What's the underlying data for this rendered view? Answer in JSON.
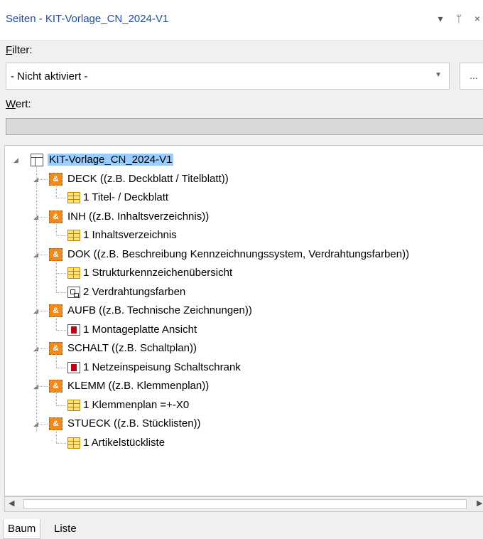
{
  "window": {
    "title": "Seiten - KIT-Vorlage_CN_2024-V1",
    "icons": [
      "dropdown-arrow-icon",
      "pin-icon",
      "close-icon"
    ]
  },
  "filter": {
    "label_accel": "F",
    "label_rest": "ilter:",
    "value": "- Nicht aktiviert -",
    "more_button": "..."
  },
  "wert": {
    "label_accel": "W",
    "label_rest": "ert:",
    "value": ""
  },
  "tree": {
    "root": "KIT-Vorlage_CN_2024-V1",
    "groups": [
      {
        "label": "DECK ((z.B. Deckblatt / Titelblatt))",
        "pages": [
          {
            "label": "1 Titel- / Deckblatt",
            "icon": "table-page-icon"
          }
        ]
      },
      {
        "label": "INH ((z.B. Inhaltsverzeichnis))",
        "pages": [
          {
            "label": "1 Inhaltsverzeichnis",
            "icon": "table-page-icon"
          }
        ]
      },
      {
        "label": "DOK ((z.B. Beschreibung Kennzeichnungssystem, Verdrahtungsfarben))",
        "pages": [
          {
            "label": "1 Strukturkennzeichenübersicht",
            "icon": "table-page-icon"
          },
          {
            "label": "2 Verdrahtungsfarben",
            "icon": "graphic-page-icon"
          }
        ]
      },
      {
        "label": "AUFB ((z.B. Technische Zeichnungen))",
        "pages": [
          {
            "label": "1 Montageplatte Ansicht",
            "icon": "schematic-page-icon"
          }
        ]
      },
      {
        "label": "SCHALT ((z.B. Schaltplan))",
        "pages": [
          {
            "label": "1 Netzeinspeisung Schaltschrank",
            "icon": "schematic-page-icon"
          }
        ]
      },
      {
        "label": "KLEMM ((z.B. Klemmenplan))",
        "pages": [
          {
            "label": "1 Klemmenplan =+-X0",
            "icon": "table-page-icon"
          }
        ]
      },
      {
        "label": "STUECK ((z.B. Stücklisten))",
        "pages": [
          {
            "label": "1 Artikelstückliste",
            "icon": "table-page-icon"
          }
        ]
      }
    ]
  },
  "tabs": [
    "Baum",
    "Liste"
  ]
}
